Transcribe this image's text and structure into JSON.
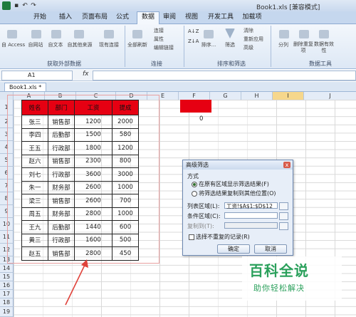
{
  "titlebar": {
    "title": "Book1.xls [兼容模式]"
  },
  "tabs": [
    "开始",
    "插入",
    "页面布局",
    "公式",
    "数据",
    "审阅",
    "视图",
    "开发工具",
    "加载项"
  ],
  "ribbon": {
    "ext_group": {
      "btns": [
        "自 Access",
        "自网站",
        "自文本",
        "自其他来源",
        "现有连接"
      ],
      "label": "获取外部数据"
    },
    "conn_group": {
      "main": "全部刷新",
      "items": [
        "连接",
        "属性",
        "编辑链接"
      ],
      "label": "连接"
    },
    "sort_group": {
      "btns": [
        "排序...",
        "筛选"
      ],
      "items": [
        "清除",
        "重新应用",
        "高级"
      ],
      "label": "排序和筛选"
    },
    "tools_group": {
      "btns": [
        "分列",
        "删除重复项",
        "数据有效性"
      ],
      "label": "数据工具"
    }
  },
  "formula_bar": {
    "namebox": "A1",
    "fx": "fx",
    "value": ""
  },
  "workbook_tab": "Book1.xls *",
  "columns": [
    "A",
    "B",
    "C",
    "D",
    "E",
    "F",
    "G",
    "H",
    "I",
    "J"
  ],
  "rows": [
    "1",
    "2",
    "3",
    "4",
    "5",
    "6",
    "7",
    "8",
    "9",
    "10",
    "11",
    "12",
    "13",
    "14",
    "15",
    "16",
    "17",
    "18",
    "19"
  ],
  "table": {
    "headers": [
      "姓名",
      "部门",
      "工资",
      "提成"
    ],
    "rows": [
      [
        "张三",
        "销售部",
        "1200",
        "2000"
      ],
      [
        "李四",
        "后勤部",
        "1500",
        "580"
      ],
      [
        "王五",
        "行政部",
        "1800",
        "1200"
      ],
      [
        "赵六",
        "销售部",
        "2300",
        "800"
      ],
      [
        "刘七",
        "行政部",
        "3600",
        "3000"
      ],
      [
        "朱一",
        "财务部",
        "2600",
        "1000"
      ],
      [
        "梁三",
        "销售部",
        "2600",
        "700"
      ],
      [
        "周五",
        "财务部",
        "2800",
        "1000"
      ],
      [
        "王九",
        "后勤部",
        "1440",
        "600"
      ],
      [
        "黄三",
        "行政部",
        "1600",
        "500"
      ],
      [
        "赵五",
        "销售部",
        "2800",
        "450"
      ]
    ]
  },
  "f2_value": "0",
  "dialog": {
    "title": "高级筛选",
    "close": "x",
    "section": "方式",
    "option1": "在原有区域显示筛选结果(F)",
    "option2": "将筛选结果复制到其他位置(O)",
    "list_label": "列表区域(L):",
    "list_value": "工资!$A$1:$D$12",
    "criteria_label": "条件区域(C):",
    "criteria_value": "",
    "copyto_label": "复制到(T):",
    "copyto_value": "",
    "unique_label": "选择不重复的记录(R)",
    "ok": "确定",
    "cancel": "取消"
  },
  "watermark": {
    "title": "百科全说",
    "subtitle": "助你轻松解决"
  }
}
